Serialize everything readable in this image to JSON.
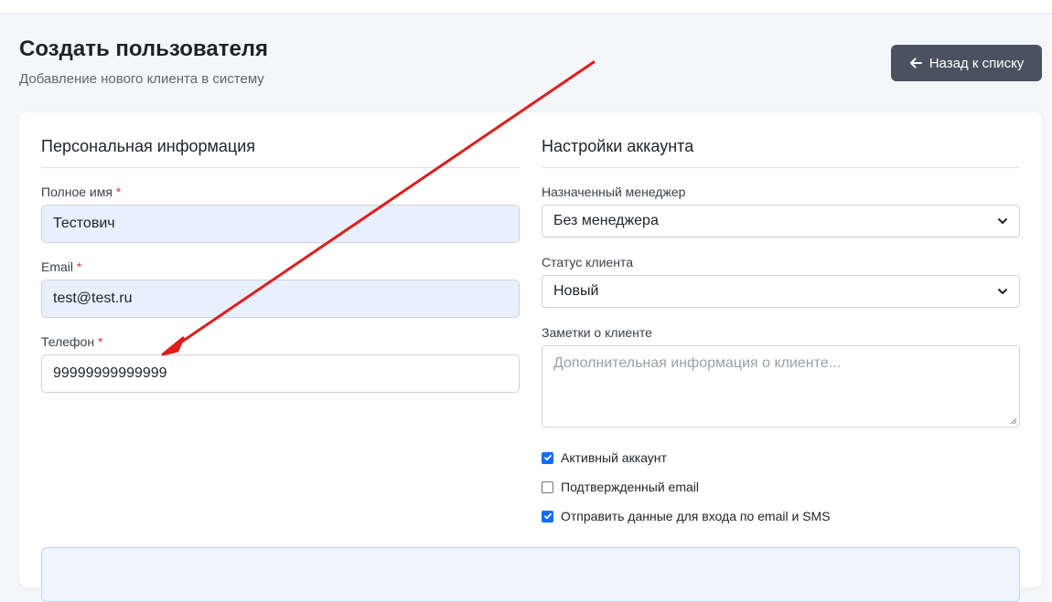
{
  "header": {
    "title": "Создать пользователя",
    "subtitle": "Добавление нового клиента в систему",
    "back_button_label": "Назад к списку",
    "back_icon": "arrow-left-icon"
  },
  "personal": {
    "section_title": "Персональная информация",
    "full_name": {
      "label": "Полное имя",
      "required": "*",
      "value": "Тестович"
    },
    "email": {
      "label": "Email",
      "required": "*",
      "value": "test@test.ru"
    },
    "phone": {
      "label": "Телефон",
      "required": "*",
      "value": "99999999999999"
    }
  },
  "account": {
    "section_title": "Настройки аккаунта",
    "manager": {
      "label": "Назначенный менеджер",
      "selected": "Без менеджера"
    },
    "status": {
      "label": "Статус клиента",
      "selected": "Новый"
    },
    "notes": {
      "label": "Заметки о клиенте",
      "placeholder": "Дополнительная информация о клиенте..."
    },
    "checkboxes": [
      {
        "label": "Активный аккаунт",
        "checked": true
      },
      {
        "label": "Подтвержденный email",
        "checked": false
      },
      {
        "label": "Отправить данные для входа по email и SMS",
        "checked": true
      }
    ]
  },
  "colors": {
    "accent": "#0d6efd",
    "back_button_bg": "#4a5260",
    "required_mark": "#dc3545",
    "autofill_bg": "#e8f0fe",
    "annotation_arrow": "#e31b1b"
  }
}
